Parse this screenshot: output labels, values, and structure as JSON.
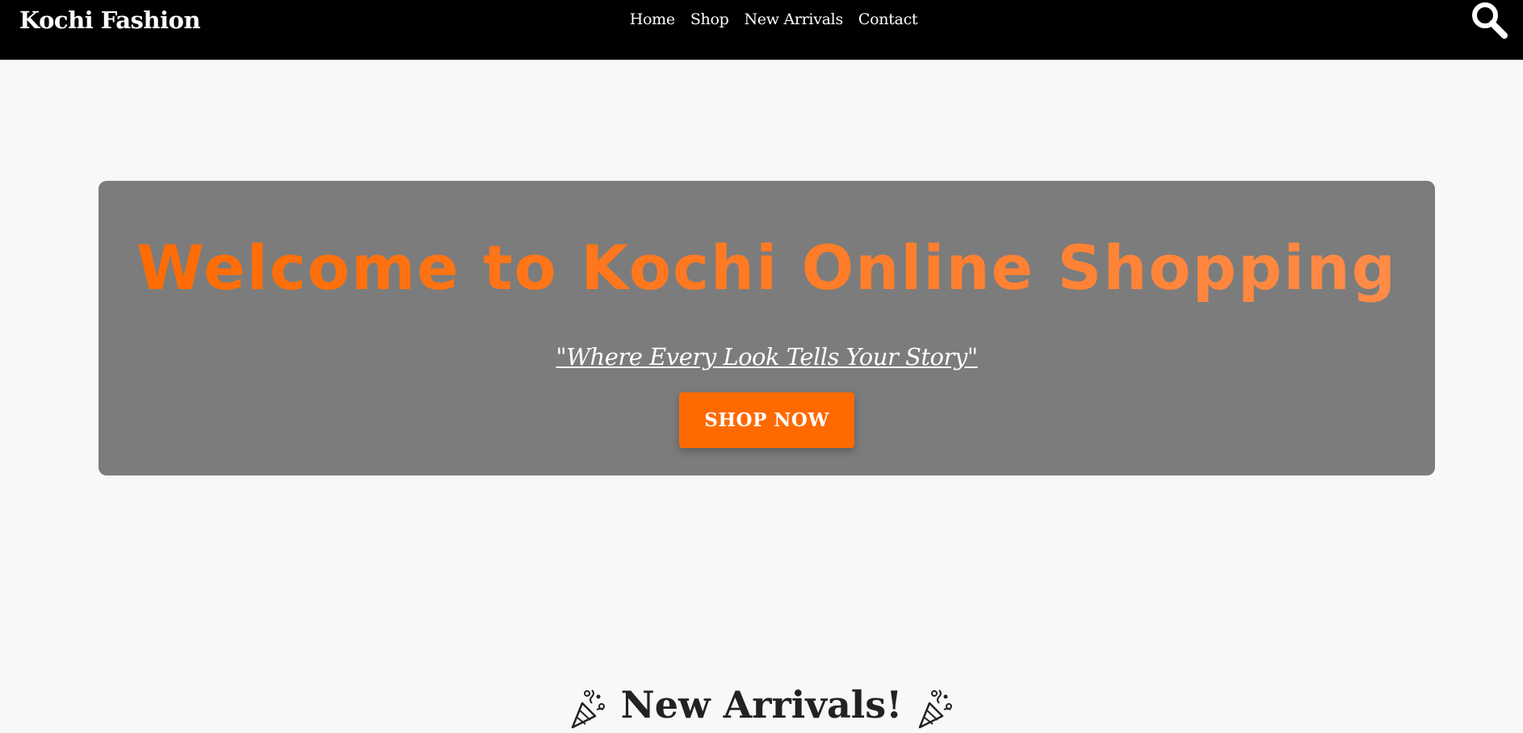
{
  "header": {
    "brand": "Kochi Fashion",
    "nav": [
      "Home",
      "Shop",
      "New Arrivals",
      "Contact"
    ],
    "search_icon": "search-icon"
  },
  "hero": {
    "title": "Welcome to Kochi Online Shopping",
    "tagline": "\"Where Every Look Tells Your Story\"",
    "cta_label": "SHOP NOW"
  },
  "new_arrivals": {
    "heading": "New Arrivals!",
    "icon": "party-popper-icon"
  },
  "colors": {
    "header_bg": "#000000",
    "page_bg": "#f8f8f8",
    "hero_bg": "#7c7c7c",
    "accent": "#ff6a00",
    "accent_light": "#ff8c4a"
  }
}
